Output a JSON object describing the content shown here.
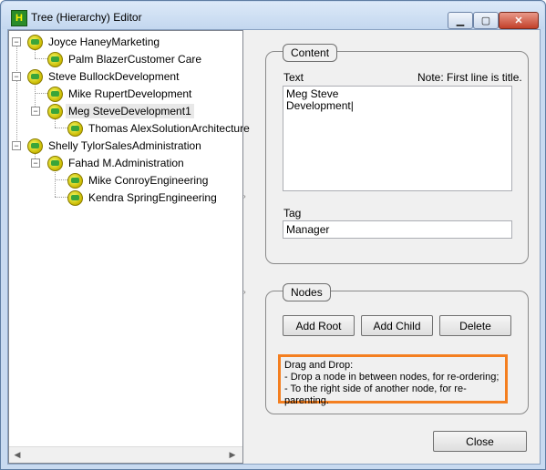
{
  "window": {
    "title": "Tree (Hierarchy) Editor",
    "icon_glyph": "H",
    "min_glyph": "▁",
    "max_glyph": "▢",
    "close_glyph": "✕"
  },
  "tree": {
    "nodes": [
      {
        "label": "Joyce HaneyMarketing",
        "expander": "−"
      },
      {
        "label": "Palm BlazerCustomer Care"
      },
      {
        "label": "Steve BullockDevelopment",
        "expander": "−"
      },
      {
        "label": "Mike RupertDevelopment"
      },
      {
        "label": "Meg SteveDevelopment1",
        "expander": "−",
        "selected": true
      },
      {
        "label": "Thomas AlexSolutionArchitecture"
      },
      {
        "label": "Shelly TylorSalesAdministration",
        "expander": "−"
      },
      {
        "label": "Fahad M.Administration",
        "expander": "−"
      },
      {
        "label": "Mike ConroyEngineering"
      },
      {
        "label": "Kendra SpringEngineering"
      }
    ],
    "scroll_left": "◀",
    "scroll_right": "▶"
  },
  "splitter": {
    "grip_top": "›",
    "grip_bottom": "›"
  },
  "content_group": {
    "legend": "Content",
    "text_label": "Text",
    "note": "Note: First line is title.",
    "text_value": "Meg Steve\nDevelopment|",
    "tag_label": "Tag",
    "tag_value": "Manager"
  },
  "nodes_group": {
    "legend": "Nodes",
    "add_root": "Add Root",
    "add_child": "Add Child",
    "delete": "Delete",
    "hint_line1": "Drag and Drop:",
    "hint_line2": "- Drop a node in between nodes, for re-ordering;",
    "hint_line3": "- To the right side of another node, for re-parenting."
  },
  "close_button": "Close",
  "colors": {
    "hint_border": "#f47f20",
    "title_bg": "#c8daf0"
  }
}
